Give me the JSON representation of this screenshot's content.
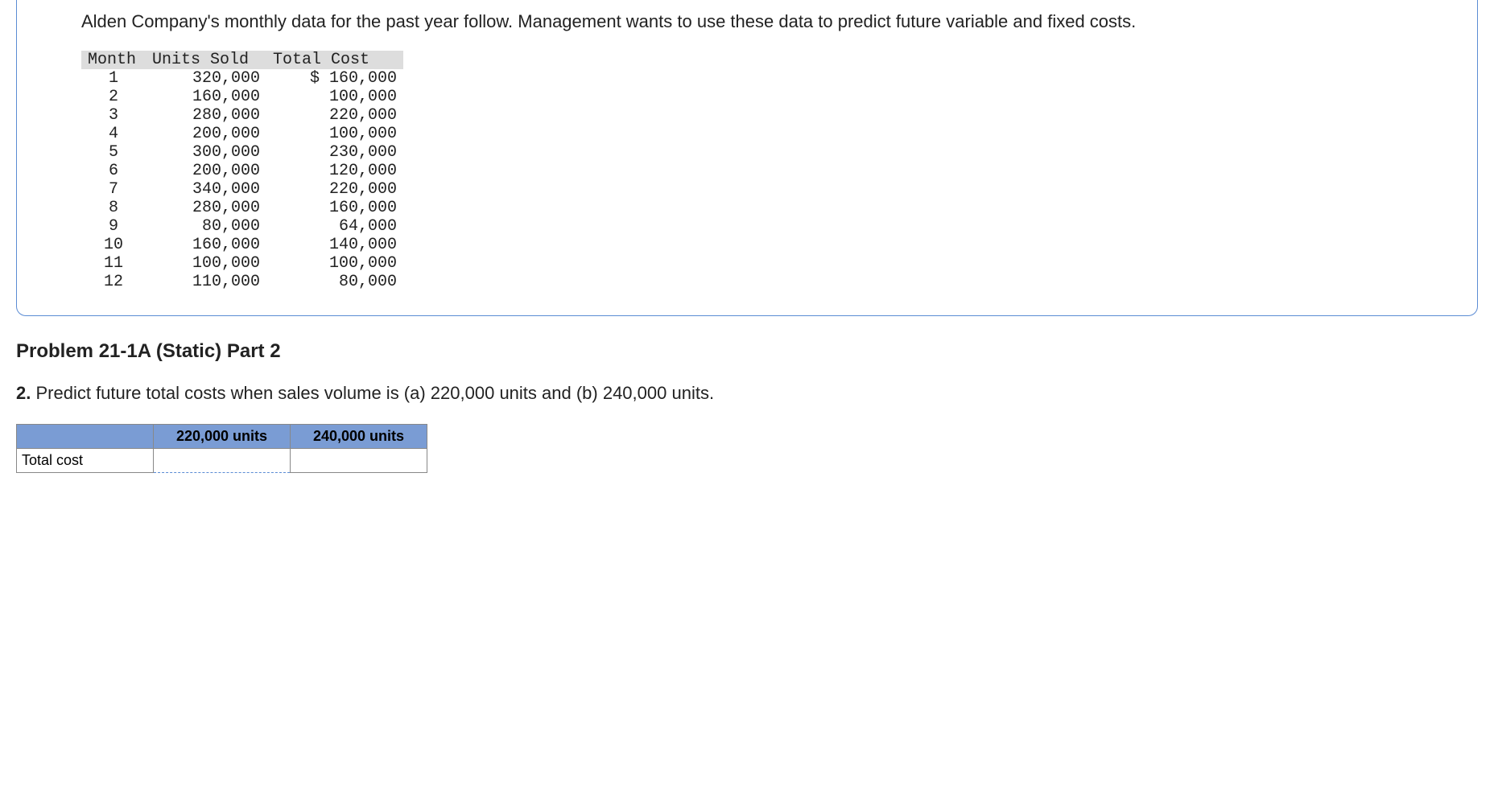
{
  "intro": "Alden Company's monthly data for the past year follow. Management wants to use these data to predict future variable and fixed costs.",
  "table": {
    "headers": {
      "month": "Month",
      "units": "Units Sold",
      "cost": "Total Cost"
    },
    "rows": [
      {
        "month": "1",
        "units": "320,000",
        "cost": "$ 160,000"
      },
      {
        "month": "2",
        "units": "160,000",
        "cost": "100,000"
      },
      {
        "month": "3",
        "units": "280,000",
        "cost": "220,000"
      },
      {
        "month": "4",
        "units": "200,000",
        "cost": "100,000"
      },
      {
        "month": "5",
        "units": "300,000",
        "cost": "230,000"
      },
      {
        "month": "6",
        "units": "200,000",
        "cost": "120,000"
      },
      {
        "month": "7",
        "units": "340,000",
        "cost": "220,000"
      },
      {
        "month": "8",
        "units": "280,000",
        "cost": "160,000"
      },
      {
        "month": "9",
        "units": "80,000",
        "cost": "64,000"
      },
      {
        "month": "10",
        "units": "160,000",
        "cost": "140,000"
      },
      {
        "month": "11",
        "units": "100,000",
        "cost": "100,000"
      },
      {
        "month": "12",
        "units": "110,000",
        "cost": "80,000"
      }
    ]
  },
  "problem_title": "Problem 21-1A (Static) Part 2",
  "question": {
    "num": "2.",
    "text": "Predict future total costs when sales volume is (a) 220,000 units and (b) 240,000 units."
  },
  "answer_table": {
    "col1": "220,000 units",
    "col2": "240,000 units",
    "row_label": "Total cost"
  }
}
